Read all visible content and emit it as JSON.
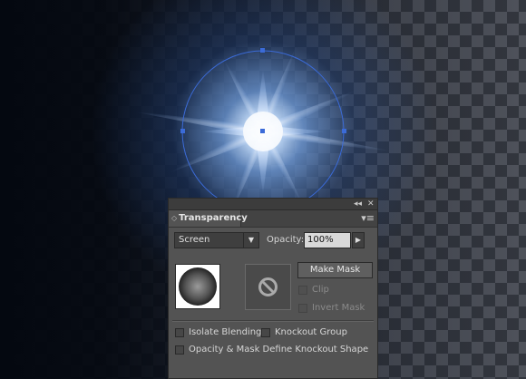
{
  "panel": {
    "collapse_label": "◂◂",
    "close_label": "✕",
    "tab_arrows": "◇",
    "title": "Transparency",
    "menu_label": "▾≡",
    "blend_mode": "Screen",
    "opacity_label": "Opacity:",
    "opacity_value": "100%",
    "make_mask_label": "Make Mask",
    "clip_label": "Clip",
    "invert_mask_label": "Invert Mask",
    "isolate_blending_label": "Isolate Blending",
    "knockout_group_label": "Knockout Group",
    "opacity_mask_define_label": "Opacity & Mask Define Knockout Shape"
  },
  "colors": {
    "panel_bg": "#535353",
    "selection_blue": "#3b6bd8"
  },
  "icons": [
    "circle-slash-icon",
    "dropdown-caret-icon",
    "right-arrow-icon",
    "panel-menu-icon"
  ]
}
